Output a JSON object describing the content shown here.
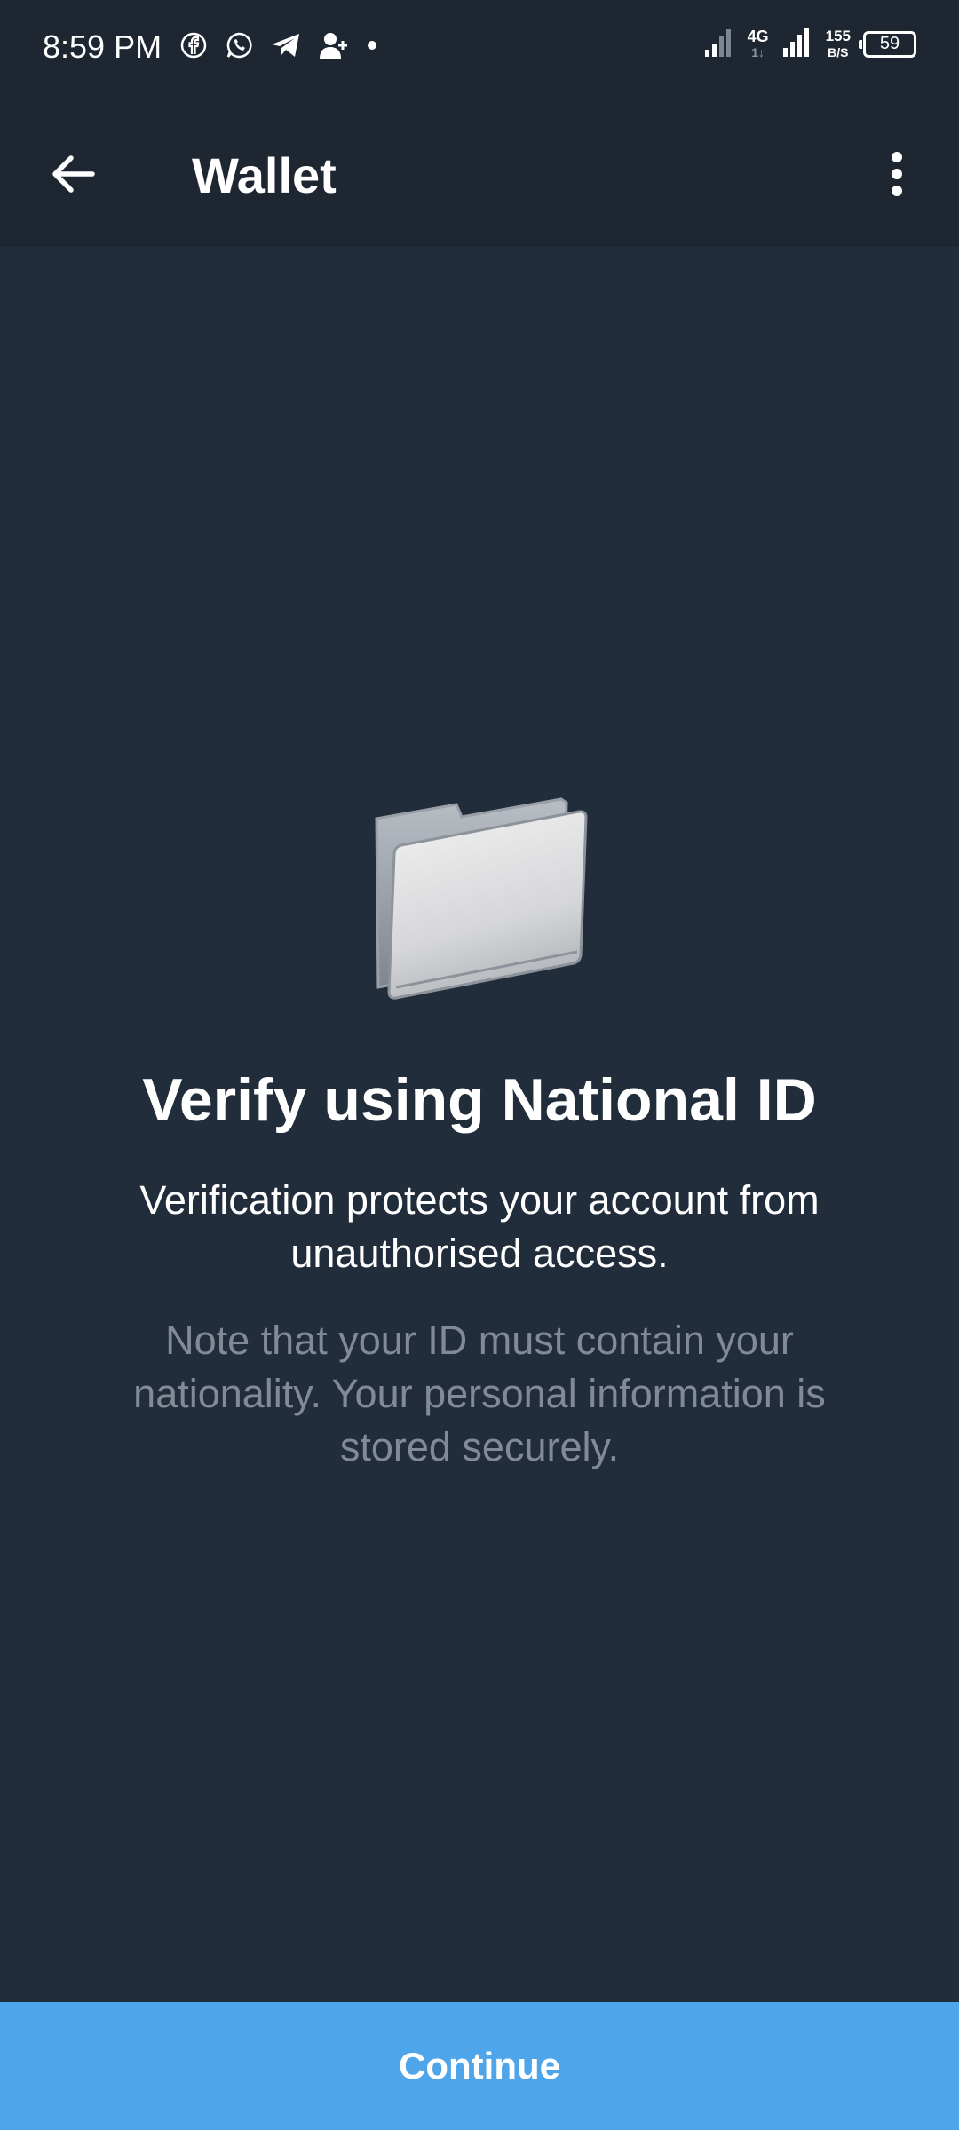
{
  "status_bar": {
    "time": "8:59 PM",
    "network_type": "4G",
    "network_sub": "1↓",
    "speed_value": "155",
    "speed_unit": "B/S",
    "battery": "59",
    "icons": [
      "facebook-icon",
      "whatsapp-icon",
      "telegram-icon",
      "add-user-icon",
      "dot-icon",
      "signal-icon",
      "signal-icon"
    ]
  },
  "app_bar": {
    "title": "Wallet",
    "back_icon": "arrow-left-icon",
    "menu_icon": "more-vertical-icon"
  },
  "content": {
    "illustration": "folder-icon",
    "headline": "Verify using National ID",
    "description": "Verification protects your account from unauthorised access.",
    "note": "Note that your ID must contain your nationality. Your personal information is stored securely."
  },
  "footer": {
    "continue_label": "Continue"
  },
  "colors": {
    "background": "#222d3b",
    "bar_background": "#1e2631",
    "accent": "#4ea5e9",
    "note_text": "#818a96"
  }
}
